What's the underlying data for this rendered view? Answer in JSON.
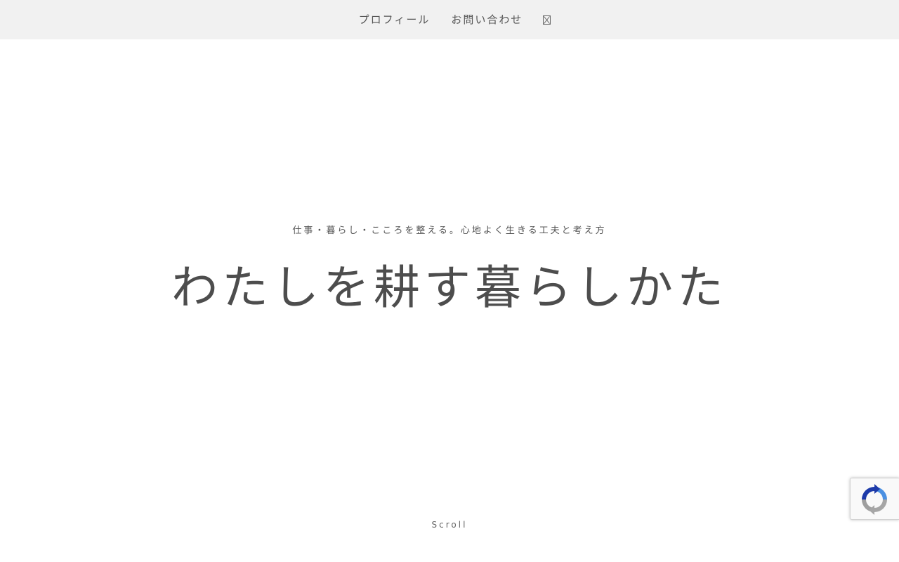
{
  "nav": {
    "items": [
      {
        "label": "プロフィール"
      },
      {
        "label": "お問い合わせ"
      }
    ],
    "social_icon": "x-icon"
  },
  "hero": {
    "tagline": "仕事・暮らし・こころを整える。心地よく生きる工夫と考え方",
    "title": "わたしを耕す暮らしかた",
    "scroll_label": "Scroll"
  },
  "recaptcha": {
    "icon": "recaptcha-icon"
  },
  "colors": {
    "nav_bg": "#f1f1f1",
    "text": "#4a4a4a",
    "recaptcha_blue": "#1c3aa9",
    "recaptcha_gray": "#a6a6a6"
  }
}
